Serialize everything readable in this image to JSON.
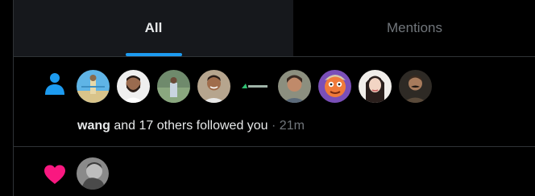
{
  "tabs": {
    "all_label": "All",
    "mentions_label": "Mentions",
    "active": "All"
  },
  "follow_notification": {
    "icon": "person-icon",
    "icon_color": "#1d9bf0",
    "avatar_count": 10,
    "actor_name": "wang",
    "others_text": " and 17 others followed you",
    "separator": " · ",
    "time": "21m"
  },
  "like_notification": {
    "icon": "heart-icon",
    "icon_color": "#f91880",
    "avatar_count": 1
  },
  "colors": {
    "accent": "#1d9bf0",
    "like": "#f91880",
    "background": "#000000",
    "active_tab_background": "#16181c",
    "divider": "#2f3336",
    "muted_text": "#71767b",
    "primary_text": "#e7e9ea"
  }
}
